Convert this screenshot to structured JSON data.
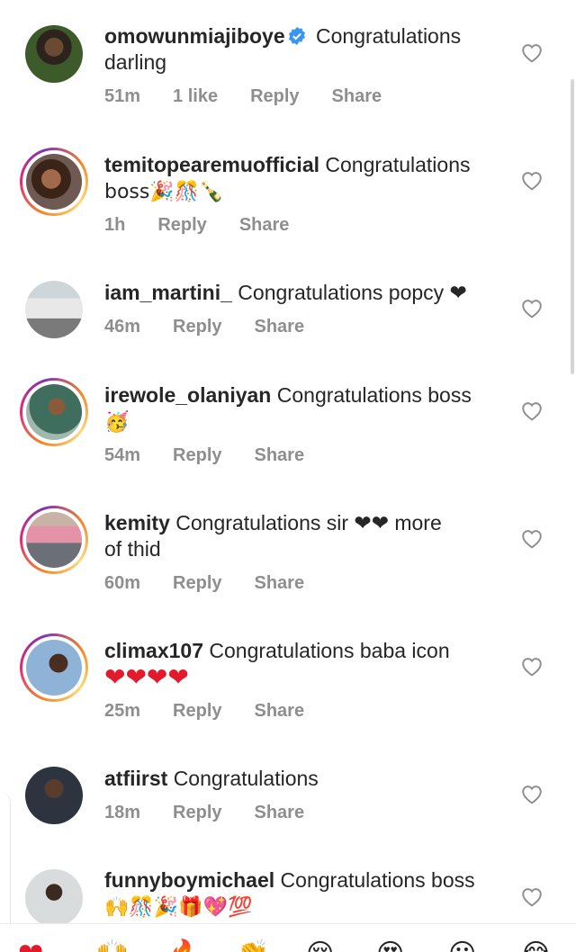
{
  "comments": [
    {
      "username": "omowunmiajiboye",
      "verified": true,
      "text_lines": [
        "Congratulations",
        "darling"
      ],
      "time": "51m",
      "likes": "1 like",
      "reply": "Reply",
      "share": "Share"
    },
    {
      "username": "temitopearemuofficial",
      "text_lines": [
        "Congratulations",
        "boss🎉🎊🍾"
      ],
      "time": "1h",
      "reply": "Reply",
      "share": "Share"
    },
    {
      "username": "iam_martini_",
      "text_lines": [
        "Congratulations popcy ❤"
      ],
      "time": "46m",
      "reply": "Reply",
      "share": "Share"
    },
    {
      "username": "irewole_olaniyan",
      "text_lines": [
        "Congratulations boss",
        "🥳"
      ],
      "time": "54m",
      "reply": "Reply",
      "share": "Share"
    },
    {
      "username": "kemity",
      "text_lines": [
        "Congratulations sir ❤❤ more",
        "of thid"
      ],
      "time": "60m",
      "reply": "Reply",
      "share": "Share"
    },
    {
      "username": "climax107",
      "text_lines": [
        "Congratulations baba icon",
        "❤❤❤❤"
      ],
      "time": "25m",
      "reply": "Reply",
      "share": "Share"
    },
    {
      "username": "atfiirst",
      "text_lines": [
        "Congratulations"
      ],
      "time": "18m",
      "reply": "Reply",
      "share": "Share"
    },
    {
      "username": "funnyboymichael",
      "text_lines": [
        "Congratulations boss",
        "🙌🎊🎉🎁💖💯"
      ]
    }
  ],
  "reaction_bar": [
    "❤",
    "🙌",
    "🔥",
    "👏",
    "😢",
    "😍",
    "😮",
    "😂"
  ],
  "colors": {
    "text": "#262626",
    "meta": "#8e8e8e",
    "verified": "#3897f0",
    "heart": "#e21a2c"
  },
  "icons": {
    "like": "heart-outline-icon",
    "verified": "verified-badge-icon"
  }
}
